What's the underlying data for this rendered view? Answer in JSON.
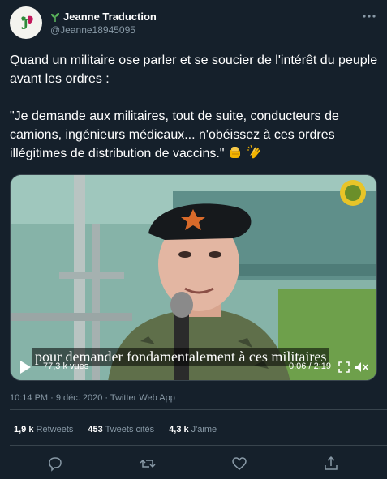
{
  "author": {
    "name": "Jeanne Traduction",
    "handle": "@Jeanne18945095"
  },
  "tweet": {
    "text": "Quand un militaire ose parler et se soucier de l'intérêt du peuple avant les ordres :\n\n\"Je demande aux militaires, tout de suite, conducteurs de camions, ingénieurs médicaux... n'obéissez à ces ordres illégitimes de distribution de vaccins.\"",
    "emojis": [
      "fist-emoji",
      "clapping-hands-emoji"
    ]
  },
  "video": {
    "subtitle": "pour demander fondamentalement à ces militaires",
    "views": "77,3 k vues",
    "time": "0:06 / 2:19"
  },
  "meta": {
    "timestamp": "10:14 PM · 9 déc. 2020 · Twitter Web App"
  },
  "stats": {
    "retweets_count": "1,9 k",
    "retweets_label": "Retweets",
    "quotes_count": "453",
    "quotes_label": "Tweets cités",
    "likes_count": "4,3 k",
    "likes_label": "J'aime"
  },
  "colors": {
    "background": "#15202b",
    "secondary_text": "#8899a6",
    "divider": "#38444d",
    "brand_green": "#2e8b3a",
    "brand_pink": "#c2185b"
  }
}
